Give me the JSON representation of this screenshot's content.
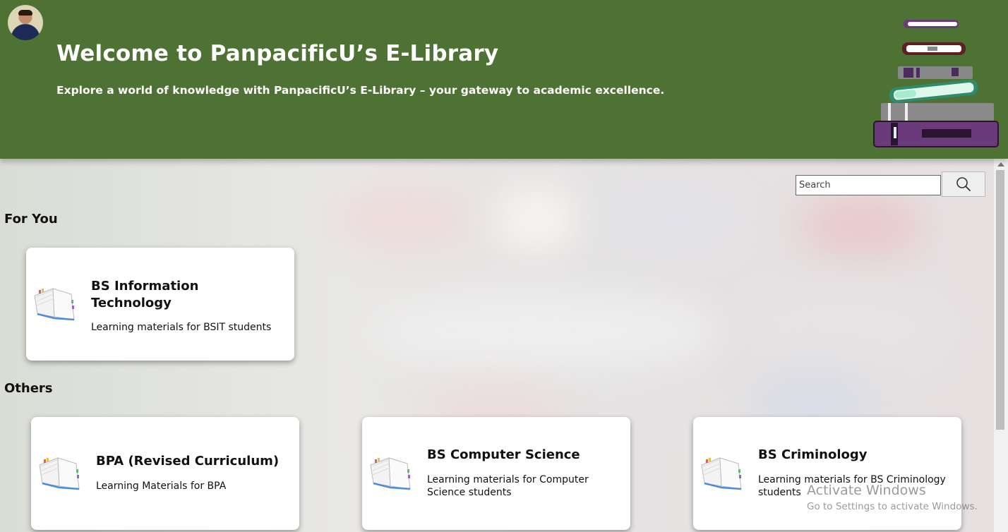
{
  "header": {
    "title": "Welcome to PanpacificU’s E-Library",
    "subtitle": "Explore a world of knowledge with PanpacificU’s E-Library – your gateway to academic excellence.",
    "background_color": "#4e7134"
  },
  "search": {
    "placeholder": "Search",
    "value": ""
  },
  "sections": {
    "for_you": "For You",
    "others": "Others"
  },
  "for_you_cards": [
    {
      "title": "BS Information Technology",
      "description": "Learning materials for BSIT students",
      "icon": "open-book-icon"
    }
  ],
  "others_cards": [
    {
      "title": "BPA (Revised Curriculum)",
      "description": "Learning Materials for BPA",
      "icon": "open-book-icon"
    },
    {
      "title": "BS Computer Science",
      "description": "Learning materials for Computer Science students",
      "icon": "open-book-icon"
    },
    {
      "title": "BS Criminology",
      "description": "Learning materials for BS Criminology students",
      "icon": "open-book-icon"
    }
  ],
  "watermark": {
    "line1": "Activate Windows",
    "line2": "Go to Settings to activate Windows."
  }
}
